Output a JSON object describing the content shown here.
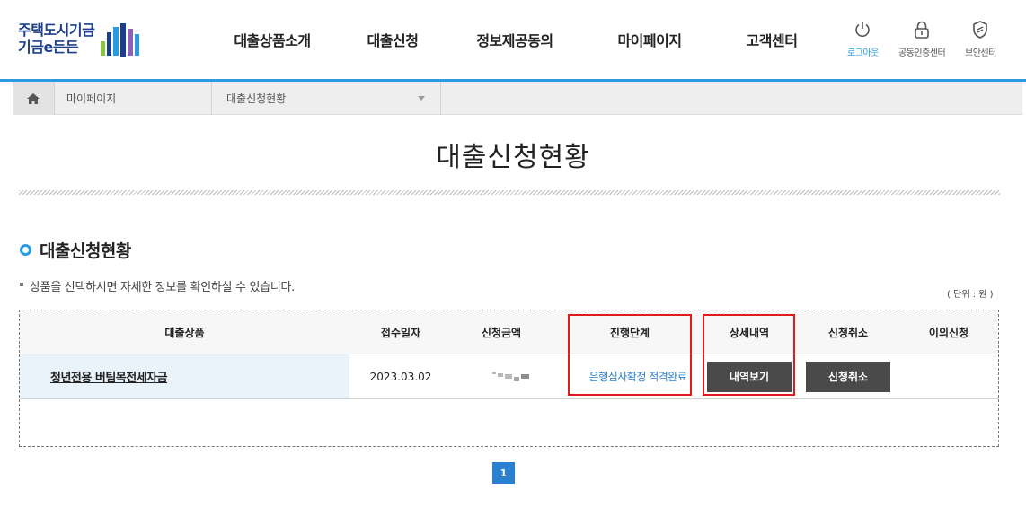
{
  "header": {
    "logo": {
      "line1": "주택도시기금",
      "line2": "기금e든든"
    },
    "nav": [
      {
        "label": "대출상품소개"
      },
      {
        "label": "대출신청"
      },
      {
        "label": "정보제공동의"
      },
      {
        "label": "마이페이지"
      },
      {
        "label": "고객센터"
      }
    ],
    "utils": [
      {
        "label": "로그아웃",
        "icon": "power-icon"
      },
      {
        "label": "공동인증센터",
        "icon": "lock-icon"
      },
      {
        "label": "보안센터",
        "icon": "shield-icon"
      }
    ]
  },
  "breadcrumb": {
    "home_icon": "home-icon",
    "level1": "마이페이지",
    "level2": "대출신청현황"
  },
  "page": {
    "title": "대출신청현황",
    "section_title": "대출신청현황",
    "note": "상품을 선택하시면 자세한 정보를 확인하실 수 있습니다.",
    "unit": "( 단위 : 원 )"
  },
  "table": {
    "columns": [
      "대출상품",
      "접수일자",
      "신청금액",
      "진행단계",
      "상세내역",
      "신청취소",
      "이의신청"
    ],
    "rows": [
      {
        "product": "청년전용 버팀목전세자금",
        "date": "2023.03.02",
        "amount": "",
        "status": "은행심사확정 적격완료",
        "detail_button": "내역보기",
        "cancel_button": "신청취소",
        "objection": ""
      }
    ]
  },
  "pagination": {
    "current": "1"
  },
  "colors": {
    "accent": "#2a9be0",
    "link_blue": "#2a7fd0",
    "button_dark": "#4a4a4a",
    "highlight_red": "#e21a1a",
    "product_cell_bg": "#eaf2fa"
  }
}
